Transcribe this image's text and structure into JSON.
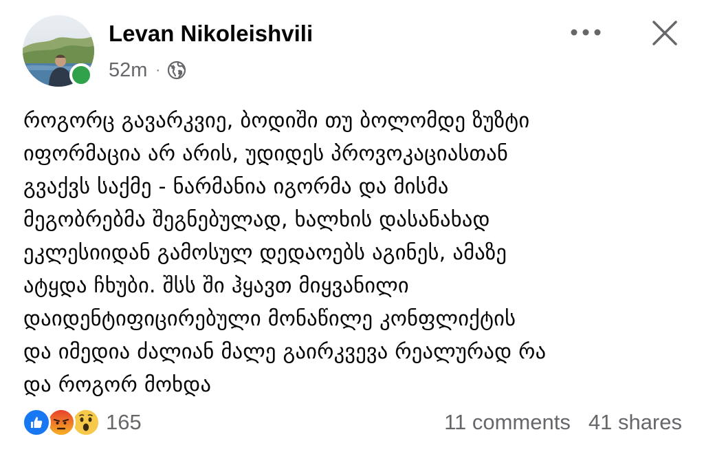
{
  "post": {
    "author": "Levan Nikoleishvili",
    "time": "52m",
    "separator": "·",
    "audience_icon": "globe-icon",
    "body_lines": [
      "როგორც გავარკვიე, ბოდიში თუ ბოლომდე ზუზტი",
      "იფორმაცია არ არის, უდიდეს პროვოკაციასთან",
      "გვაქვს საქმე - ნარმანია იგორმა და მისმა",
      "მეგობრებმა შეგნებულად, ხალხის დასანახად",
      "ეკლესიიდან გამოსულ დედაოებს აგინეს, ამაზე",
      "ატყდა ჩხუბი. შსს ში ჰყავთ მიყვანილი",
      "დაიდენტიფიცირებული მონაწილე კონფლიქტის",
      "და იმედია ძალიან მალე გაირკვევა რეალურად რა",
      "და როგორ მოხდა"
    ]
  },
  "reactions": {
    "icons": [
      "like-icon",
      "angry-icon",
      "wow-icon"
    ],
    "count": "165"
  },
  "stats": {
    "comments": "11 comments",
    "shares": "41 shares"
  },
  "colors": {
    "like": "#1877f2",
    "online": "#31a24c",
    "meta_gray": "#65676b",
    "text": "#050505"
  }
}
